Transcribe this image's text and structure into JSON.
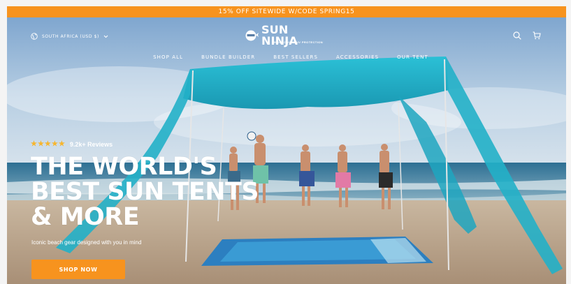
{
  "promo": {
    "text": "15% OFF SITEWIDE W/CODE SPRING15",
    "color": "#f7931e"
  },
  "header": {
    "country": "SOUTH AFRICA (USD $)",
    "logo_name": "SUN NINJA",
    "logo_tagline": "UNDERCOVER UV PROTECTION",
    "icons": [
      "globe-icon",
      "chevron-down-icon",
      "search-icon",
      "cart-icon"
    ]
  },
  "nav": {
    "items": [
      "SHOP ALL",
      "BUNDLE BUILDER",
      "BEST SELLERS",
      "ACCESSORIES",
      "OUR TENT"
    ]
  },
  "hero": {
    "stars": "★★★★★",
    "rating_count": "9.2k+ Reviews",
    "headline_line1": "THE WORLD'S",
    "headline_line2": "BEST SUN TENTS",
    "headline_line3": "& MORE",
    "subtext": "Iconic beach gear designed with you in mind",
    "cta_label": "SHOP NOW",
    "accent": "#f7931e",
    "tent_color": "#21b2c9"
  }
}
